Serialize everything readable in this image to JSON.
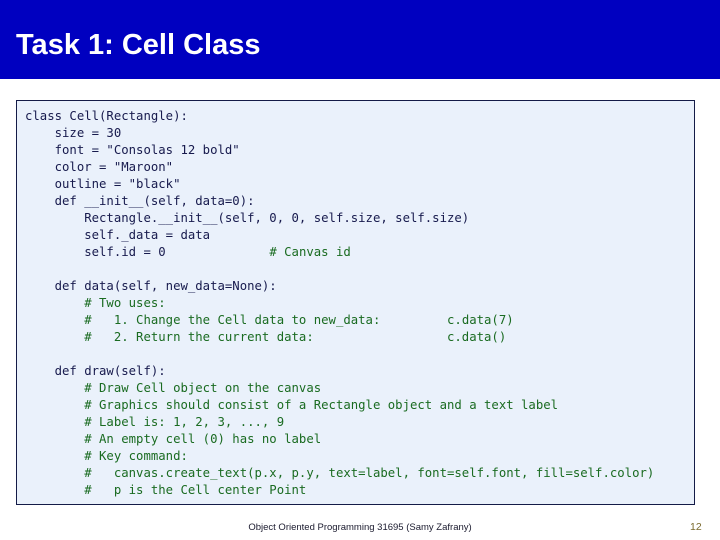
{
  "slide": {
    "title": "Task 1: Cell Class",
    "title_bar_color": "#0000C0",
    "title_color": "#FFFFFF",
    "background_color": "#FFFFFF"
  },
  "code_box": {
    "background_color": "#EAF1FB",
    "border_color": "#141B47",
    "code_color": "#171A4D",
    "comment_color": "#1A6B21",
    "lines": [
      {
        "text": "class Cell(Rectangle):",
        "kind": "code"
      },
      {
        "text": "    size = 30",
        "kind": "code"
      },
      {
        "text": "    font = \"Consolas 12 bold\"",
        "kind": "code"
      },
      {
        "text": "    color = \"Maroon\"",
        "kind": "code"
      },
      {
        "text": "    outline = \"black\"",
        "kind": "code"
      },
      {
        "text": "    def __init__(self, data=0):",
        "kind": "code"
      },
      {
        "text": "        Rectangle.__init__(self, 0, 0, self.size, self.size)",
        "kind": "code"
      },
      {
        "text": "        self._data = data",
        "kind": "code"
      },
      {
        "text": "        self.id = 0",
        "kind": "code",
        "comment": "# Canvas id",
        "comment_col": 33
      },
      {
        "text": "",
        "kind": "blank"
      },
      {
        "text": "    def data(self, new_data=None):",
        "kind": "code"
      },
      {
        "text": "        # Two uses:",
        "kind": "comment"
      },
      {
        "text": "        #   1. Change the Cell data to new_data:",
        "kind": "comment",
        "comment": "c.data(7)",
        "comment_col": 57
      },
      {
        "text": "        #   2. Return the current data:",
        "kind": "comment",
        "comment": "c.data()",
        "comment_col": 57
      },
      {
        "text": "",
        "kind": "blank"
      },
      {
        "text": "    def draw(self):",
        "kind": "code"
      },
      {
        "text": "        # Draw Cell object on the canvas",
        "kind": "comment"
      },
      {
        "text": "        # Graphics should consist of a Rectangle object and a text label",
        "kind": "comment"
      },
      {
        "text": "        # Label is: 1, 2, 3, ..., 9",
        "kind": "comment"
      },
      {
        "text": "        # An empty cell (0) has no label",
        "kind": "comment"
      },
      {
        "text": "        # Key command:",
        "kind": "comment"
      },
      {
        "text": "        #   canvas.create_text(p.x, p.y, text=label, font=self.font, fill=self.color)",
        "kind": "comment"
      },
      {
        "text": "        #   p is the Cell center Point",
        "kind": "comment"
      }
    ]
  },
  "footer": {
    "text": "Object Oriented Programming 31695  (Samy Zafrany)",
    "page_number": "12",
    "page_number_color": "#7A6A2E"
  }
}
